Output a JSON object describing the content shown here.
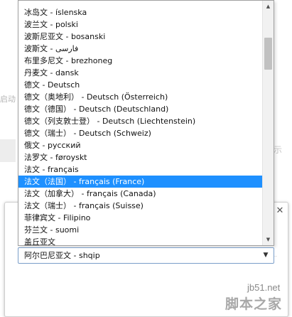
{
  "background": {
    "left_hint_text": "启动",
    "right_hint_text": "示",
    "dialog_close_icon": "close-icon"
  },
  "language_list": {
    "items": [
      "冰岛文 - íslenska",
      "波兰文 - polski",
      "波斯尼亚文 - bosanski",
      "波斯文 - فارسی",
      "布里多尼文 - brezhoneg",
      "丹麦文 - dansk",
      "德文 - Deutsch",
      "德文（奥地利） - Deutsch (Österreich)",
      "德文（德国） - Deutsch (Deutschland)",
      "德文（列支敦士登） - Deutsch (Liechtenstein)",
      "德文（瑞士） - Deutsch (Schweiz)",
      "俄文 - русский",
      "法罗文 - føroyskt",
      "法文 - français",
      "法文（法国） - français (France)",
      "法文（加拿大） - français (Canada)",
      "法文（瑞士） - français (Suisse)",
      "菲律宾文 - Filipino",
      "芬兰文 - suomi",
      "盖丘亚文"
    ],
    "selected_index": 14,
    "selection_color": "#1e90ff",
    "scroll_up_icon": "scroll-up-icon",
    "scroll_down_icon": "scroll-down-icon"
  },
  "select": {
    "value": "阿尔巴尼亚文 - shqip",
    "arrow_icon": "chevron-down-icon"
  },
  "watermark": {
    "site": "jb51.net",
    "name": "脚本之家"
  }
}
